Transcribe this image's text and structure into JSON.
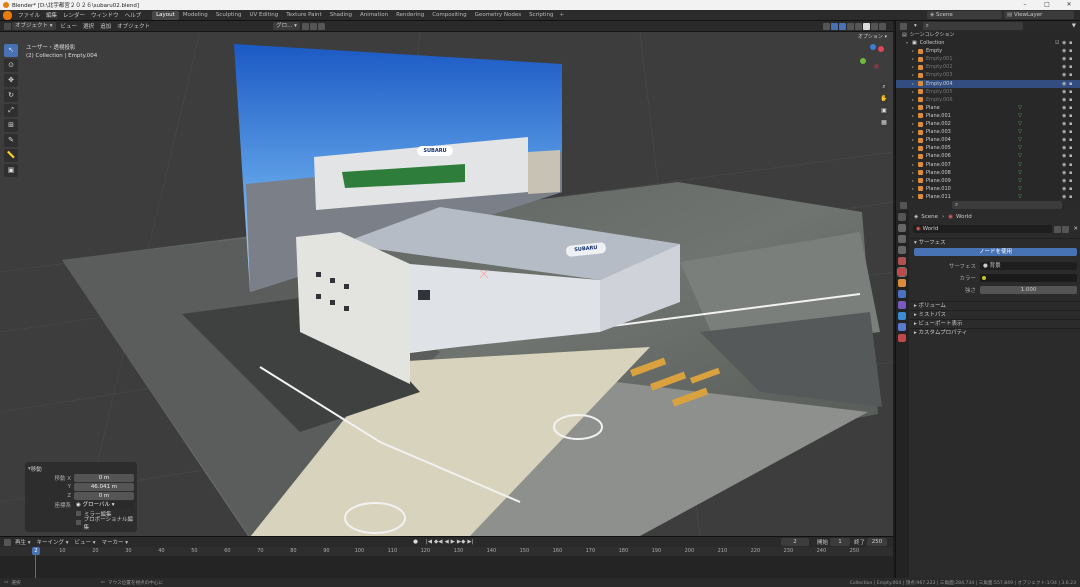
{
  "title_bar": {
    "text": "Blender* [D:\\北宇都宮２０２６\\subaru02.blend]"
  },
  "top_menu": [
    "ファイル",
    "編集",
    "レンダー",
    "ウィンドウ",
    "ヘルプ"
  ],
  "workspace_tabs": [
    "Layout",
    "Modeling",
    "Sculpting",
    "UV Editing",
    "Texture Paint",
    "Shading",
    "Animation",
    "Rendering",
    "Compositing",
    "Geometry Nodes",
    "Scripting"
  ],
  "active_workspace": "Layout",
  "scene": {
    "label": "Scene",
    "view_layer": "ViewLayer"
  },
  "viewport_header": {
    "mode": "オブジェクト",
    "menus": [
      "ビュー",
      "選択",
      "追加",
      "オブジェクト"
    ],
    "orientation": "グロ...",
    "options": "オプション"
  },
  "viewport_overlay": {
    "line1": "ユーザー・透視投影",
    "line2": "(2) Collection | Empty.004"
  },
  "operator_panel": {
    "title": "移動",
    "move_label": "移動",
    "x_label": "X",
    "x_value": "0 m",
    "y_label": "Y",
    "y_value": "46.041 m",
    "z_label": "Z",
    "z_value": "0 m",
    "orientation_label": "座標系",
    "orientation_value": "グローバル",
    "mirror_edit": "ミラー編集",
    "proportional_edit": "プロポーショナル編集"
  },
  "billboard_sign": "SUBARU",
  "hangar_sign": "SUBARU",
  "outliner": {
    "header": "シーンコレクション",
    "collection": "Collection",
    "items": [
      {
        "name": "Empty",
        "dim": false,
        "sel": false
      },
      {
        "name": "Empty.001",
        "dim": true,
        "sel": false
      },
      {
        "name": "Empty.002",
        "dim": true,
        "sel": false
      },
      {
        "name": "Empty.003",
        "dim": true,
        "sel": false
      },
      {
        "name": "Empty.004",
        "dim": false,
        "sel": true
      },
      {
        "name": "Empty.005",
        "dim": true,
        "sel": false
      },
      {
        "name": "Empty.006",
        "dim": true,
        "sel": false
      },
      {
        "name": "Plane",
        "dim": false,
        "sel": false
      },
      {
        "name": "Plane.001",
        "dim": false,
        "sel": false
      },
      {
        "name": "Plane.002",
        "dim": false,
        "sel": false
      },
      {
        "name": "Plane.003",
        "dim": false,
        "sel": false
      },
      {
        "name": "Plane.004",
        "dim": false,
        "sel": false
      },
      {
        "name": "Plane.005",
        "dim": false,
        "sel": false
      },
      {
        "name": "Plane.006",
        "dim": false,
        "sel": false
      },
      {
        "name": "Plane.007",
        "dim": false,
        "sel": false
      },
      {
        "name": "Plane.008",
        "dim": false,
        "sel": false
      },
      {
        "name": "Plane.009",
        "dim": false,
        "sel": false
      },
      {
        "name": "Plane.010",
        "dim": false,
        "sel": false
      },
      {
        "name": "Plane.011",
        "dim": false,
        "sel": false
      }
    ]
  },
  "properties": {
    "breadcrumb_scene": "Scene",
    "breadcrumb_world": "World",
    "world_name": "World",
    "surface_section": "サーフェス",
    "use_nodes_button": "ノードを使用",
    "surface_label": "サーフェス",
    "surface_value": "背景",
    "color_label": "カラー",
    "strength_label": "強さ",
    "strength_value": "1.000",
    "sections": [
      "ボリューム",
      "ミストパス",
      "ビューポート表示",
      "カスタムプロパティ"
    ]
  },
  "timeline": {
    "menus": [
      "再生",
      "キーイング",
      "ビュー",
      "マーカー"
    ],
    "current_frame": "2",
    "start_label": "開始",
    "start_value": "1",
    "end_label": "終了",
    "end_value": "250",
    "ticks": [
      "10",
      "20",
      "30",
      "40",
      "50",
      "60",
      "70",
      "80",
      "90",
      "100",
      "110",
      "120",
      "130",
      "140",
      "150",
      "160",
      "170",
      "180",
      "190",
      "200",
      "210",
      "220",
      "230",
      "240",
      "250"
    ]
  },
  "status_bar": {
    "left": "選択",
    "middle": "マウス位置を視点の中心に",
    "right": "Collection | Empty.004 | 頂点:967,223 | 三角面:284,734 | 三角面:557,849 | オブジェクト:1/34 | 3.6.23"
  },
  "colors": {
    "accent": "#4772b3",
    "selected_row": "#334d80",
    "object_orange": "#d98c3a",
    "mesh_green": "#4fc26f"
  }
}
